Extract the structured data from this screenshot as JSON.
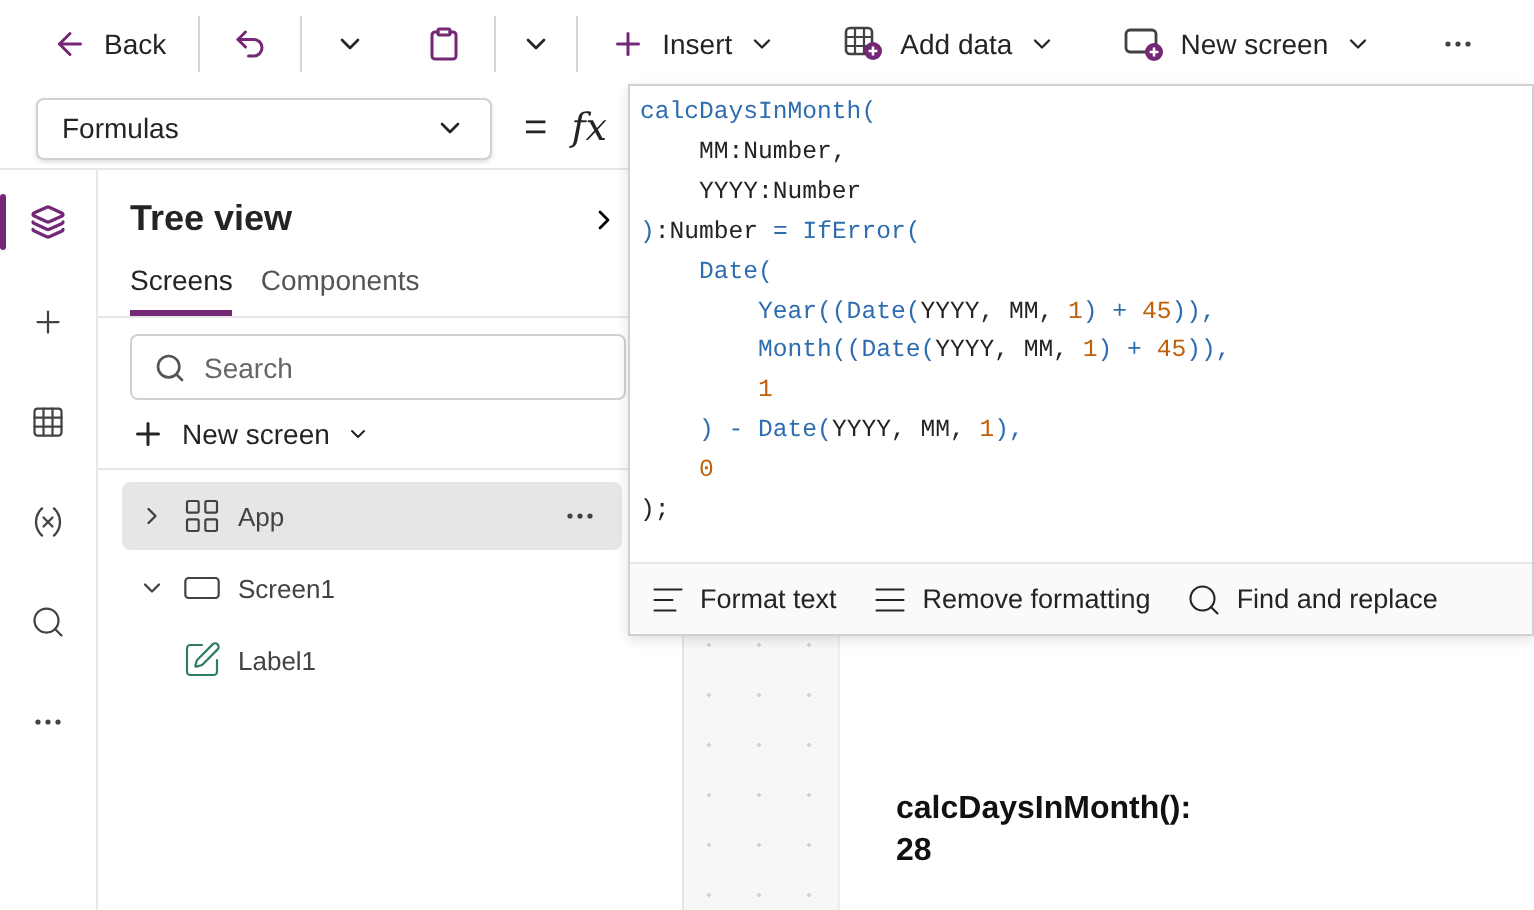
{
  "toolbar": {
    "back": "Back",
    "insert": "Insert",
    "add_data": "Add data",
    "new_screen": "New screen"
  },
  "formula_bar": {
    "property": "Formulas",
    "equals": "=",
    "fx": "fx"
  },
  "rail": [
    {
      "kind": "layers",
      "selected": true
    },
    {
      "kind": "insert",
      "selected": false
    },
    {
      "kind": "data",
      "selected": false
    },
    {
      "kind": "variables",
      "selected": false
    },
    {
      "kind": "search",
      "selected": false
    },
    {
      "kind": "more",
      "selected": false
    }
  ],
  "tree_view": {
    "title": "Tree view",
    "tabs": [
      {
        "label": "Screens",
        "selected": true
      },
      {
        "label": "Components",
        "selected": false
      }
    ],
    "search": {
      "placeholder": "Search"
    },
    "new_screen": "New screen",
    "nodes": [
      {
        "label": "App",
        "kind": "app",
        "selected": true,
        "expanded": false
      },
      {
        "label": "Screen1",
        "kind": "screen",
        "selected": false,
        "expanded": true,
        "children": [
          {
            "label": "Label1",
            "kind": "label",
            "selected": false
          }
        ]
      }
    ]
  },
  "formula_editor": {
    "lines": [
      [
        {
          "text": "calcDaysInMonth(",
          "kind": "fn"
        }
      ],
      [
        {
          "text": "    MM:Number,",
          "kind": "plain"
        }
      ],
      [
        {
          "text": "    YYYY:Number",
          "kind": "plain"
        }
      ],
      [
        {
          "text": ")",
          "kind": "fn"
        },
        {
          "text": ":Number ",
          "kind": "plain"
        },
        {
          "text": "= IfError(",
          "kind": "fn"
        }
      ],
      [
        {
          "text": "    Date(",
          "kind": "fn"
        }
      ],
      [
        {
          "text": "        Year((Date(",
          "kind": "fn"
        },
        {
          "text": "YYYY, MM, ",
          "kind": "plain"
        },
        {
          "text": "1",
          "kind": "num"
        },
        {
          "text": ") + ",
          "kind": "fn"
        },
        {
          "text": "45",
          "kind": "num"
        },
        {
          "text": ")),",
          "kind": "fn"
        }
      ],
      [
        {
          "text": "        Month((Date(",
          "kind": "fn"
        },
        {
          "text": "YYYY, MM, ",
          "kind": "plain"
        },
        {
          "text": "1",
          "kind": "num"
        },
        {
          "text": ") + ",
          "kind": "fn"
        },
        {
          "text": "45",
          "kind": "num"
        },
        {
          "text": ")),",
          "kind": "fn"
        }
      ],
      [
        {
          "text": "        1",
          "kind": "num"
        }
      ],
      [
        {
          "text": "    ) - Date(",
          "kind": "fn"
        },
        {
          "text": "YYYY, MM, ",
          "kind": "plain"
        },
        {
          "text": "1",
          "kind": "num"
        },
        {
          "text": "),",
          "kind": "fn"
        }
      ],
      [
        {
          "text": "    0",
          "kind": "num"
        }
      ],
      [
        {
          "text": ");",
          "kind": "plain"
        }
      ]
    ],
    "actions": [
      {
        "kind": "format",
        "label": "Format text"
      },
      {
        "kind": "remove",
        "label": "Remove formatting"
      },
      {
        "kind": "find",
        "label": "Find and replace"
      }
    ]
  },
  "canvas": {
    "label": "calcDaysInMonth(): 28"
  }
}
